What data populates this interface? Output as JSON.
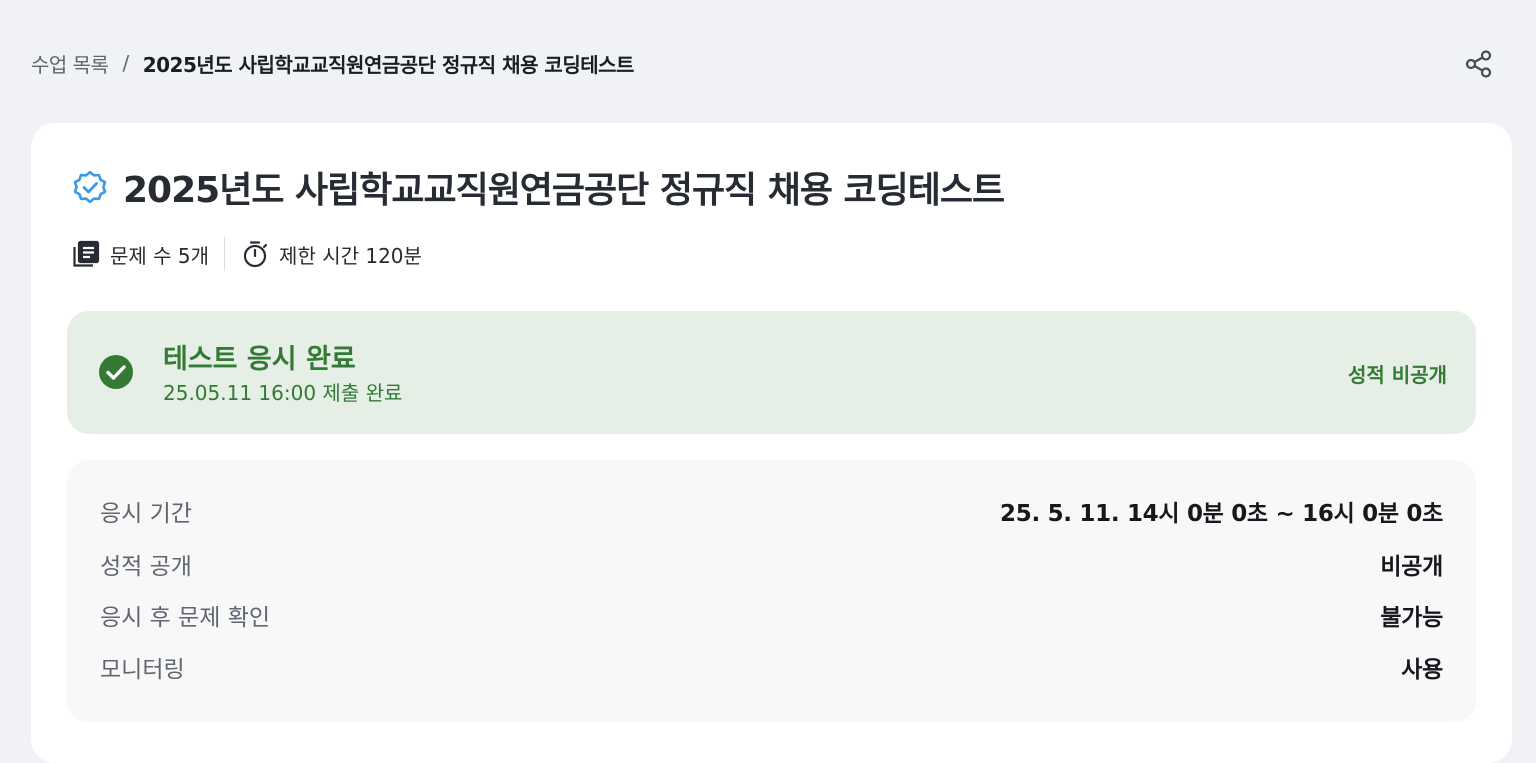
{
  "breadcrumb": {
    "parent": "수업 목록",
    "separator": "/",
    "current": "2025년도 사립학교교직원연금공단 정규직 채용 코딩테스트"
  },
  "share": {
    "icon": "share-icon"
  },
  "test": {
    "title": "2025년도 사립학교교직원연금공단 정규직 채용 코딩테스트",
    "verified_icon": "verified-badge-icon",
    "meta": {
      "problems": "문제 수 5개",
      "time_limit": "제한 시간 120분"
    }
  },
  "status": {
    "title": "테스트 응시 완료",
    "subtitle": "25.05.11 16:00 제출 완료",
    "score_visibility": "성적 비공개",
    "color": "#347a35",
    "background": "#e5efe5"
  },
  "info": [
    {
      "label": "응시 기간",
      "value": "25. 5. 11. 14시 0분 0초 ~ 16시 0분 0초"
    },
    {
      "label": "성적 공개",
      "value": "비공개"
    },
    {
      "label": "응시 후 문제 확인",
      "value": "불가능"
    },
    {
      "label": "모니터링",
      "value": "사용"
    }
  ],
  "colors": {
    "accent_blue": "#3b9be8",
    "page_background": "#f0f2f6"
  }
}
